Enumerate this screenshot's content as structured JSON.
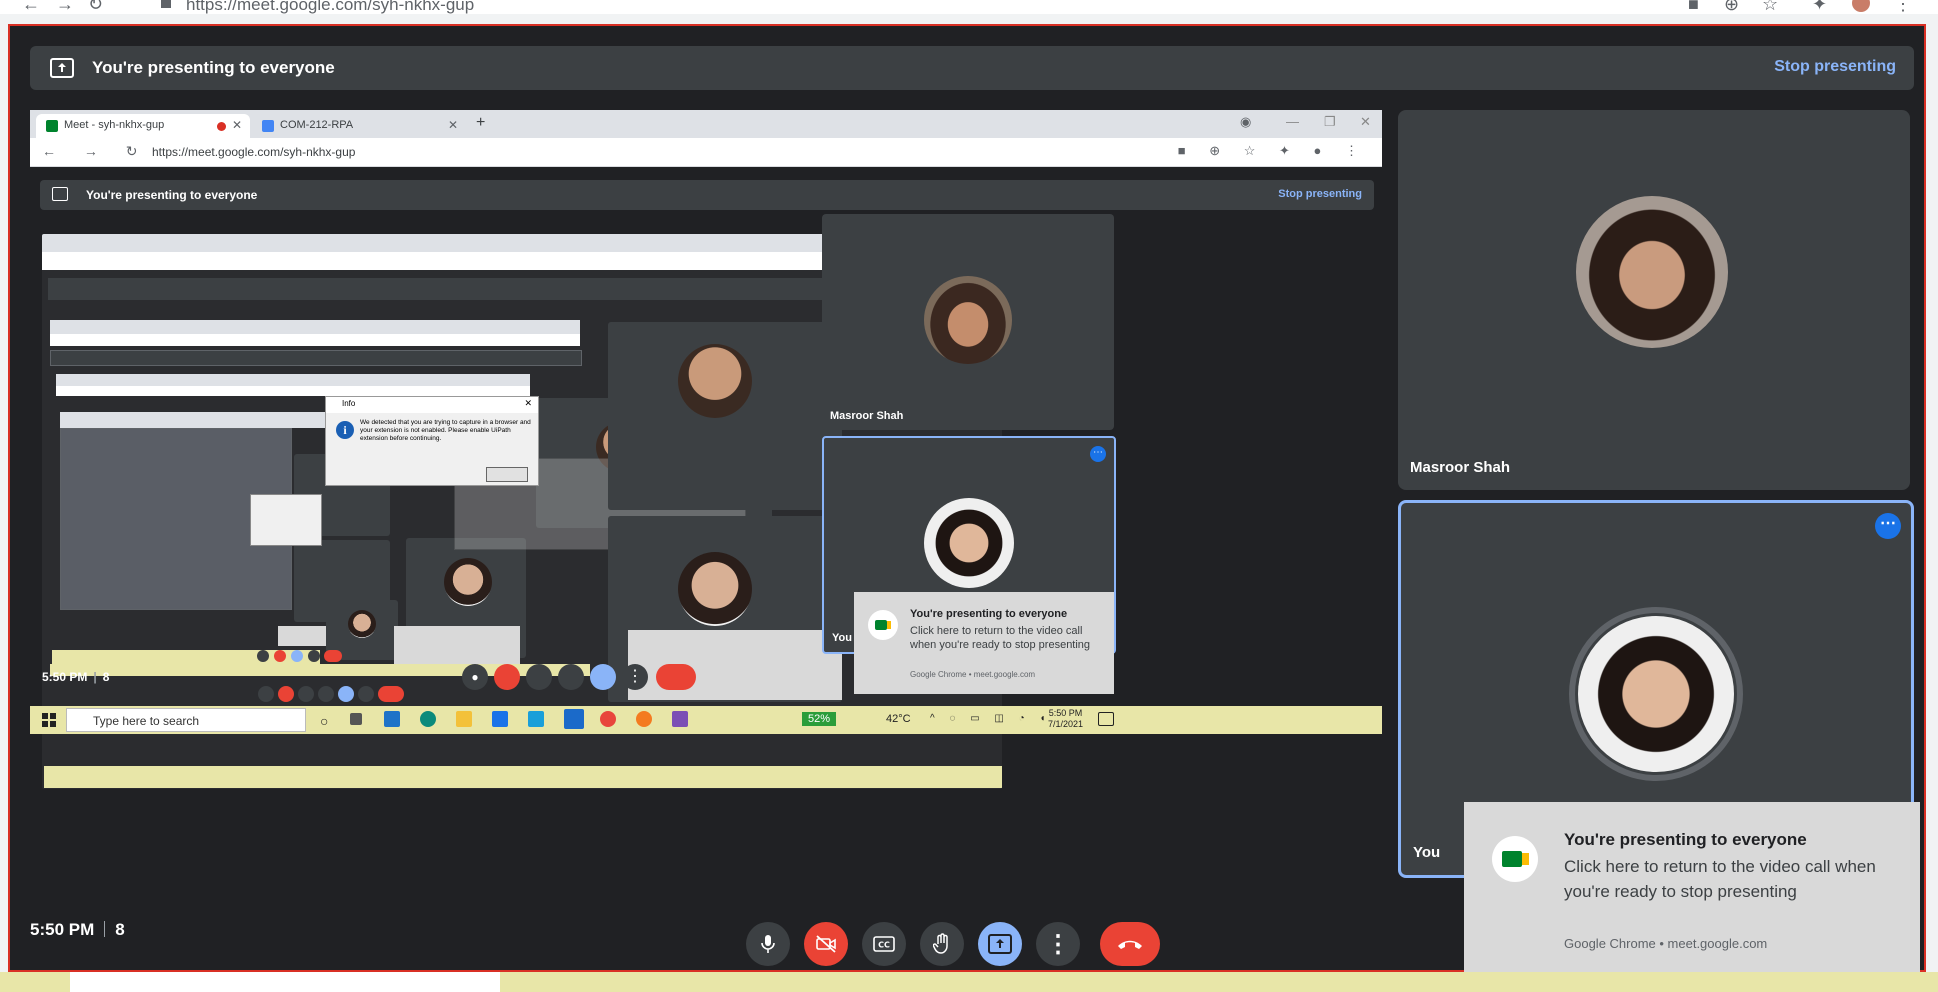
{
  "browser": {
    "url": "https://meet.google.com/syh-nkhx-gup"
  },
  "banner": {
    "title": "You're presenting to everyone",
    "stop": "Stop presenting"
  },
  "share": {
    "tabs": [
      {
        "label": "Meet - syh-nkhx-gup"
      },
      {
        "label": "COM-212-RPA"
      }
    ],
    "url": "https://meet.google.com/syh-nkhx-gup",
    "banner_title": "You're presenting to everyone",
    "banner_stop": "Stop presenting",
    "dialog": {
      "title": "Info",
      "message": "We detected that you are trying to capture in a browser and your extension is not enabled. Please enable UiPath extension before continuing."
    },
    "tiles": [
      {
        "name": "Masroor Shah"
      },
      {
        "name": "You"
      }
    ],
    "toast": {
      "title": "You're presenting to everyone",
      "body": "Click here to return to the video call when you're ready to stop presenting",
      "footer": "Google Chrome • meet.google.com"
    },
    "time": "5:50 PM",
    "count": "8",
    "taskbar": {
      "search": "Type here to search",
      "battery": "52%",
      "temp": "42°C",
      "clock_time": "5:50 PM",
      "clock_date": "7/1/2021"
    }
  },
  "tiles": [
    {
      "name": "Masroor Shah"
    },
    {
      "name": "You"
    }
  ],
  "toast": {
    "title": "You're presenting to everyone",
    "body": "Click here to return to the video call when you're ready to stop presenting",
    "footer": "Google Chrome • meet.google.com"
  },
  "bottom": {
    "time": "5:50 PM",
    "count": "8"
  },
  "icons": {
    "mic": "mic-icon",
    "camera_off": "camera-off-icon",
    "captions": "captions-icon",
    "raise_hand": "raise-hand-icon",
    "present": "present-icon",
    "more": "more-vert-icon",
    "end_call": "end-call-icon"
  },
  "colors": {
    "border": "#d93025",
    "accent": "#8ab4f8",
    "danger": "#ea4335",
    "background": "#202124",
    "tile": "#3c4043"
  }
}
